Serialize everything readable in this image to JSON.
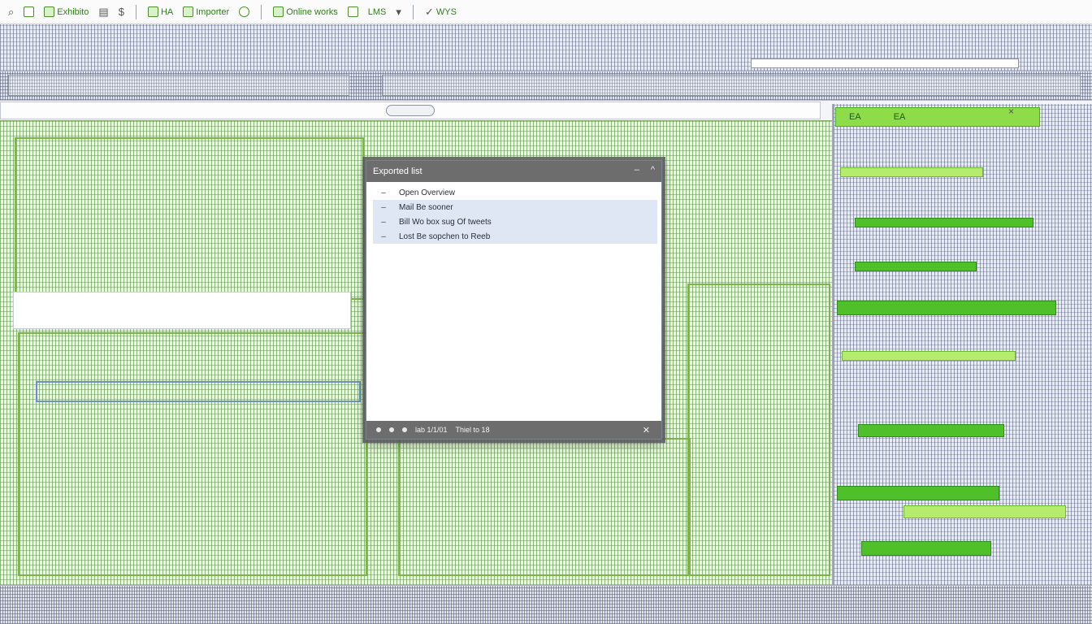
{
  "toolbar": {
    "items": [
      {
        "label": "",
        "icon": "search-icon"
      },
      {
        "label": "",
        "icon": "document-icon"
      },
      {
        "label": "Exhibito",
        "icon": "edit-icon"
      },
      {
        "label": "",
        "icon": "building-icon"
      },
      {
        "label": "",
        "icon": "dollar-icon"
      },
      {
        "label": "HA",
        "icon": "sheet-icon"
      },
      {
        "label": "Importer",
        "icon": "import-icon"
      },
      {
        "label": "",
        "icon": "settings-icon"
      },
      {
        "label": "Online works",
        "icon": "sheet-icon"
      },
      {
        "label": "",
        "icon": "grid-icon"
      },
      {
        "label": "LMS",
        "icon": "grid-icon"
      },
      {
        "label": "",
        "icon": "dropdown-icon"
      },
      {
        "label": "WYS",
        "icon": "check-icon"
      }
    ]
  },
  "dialog": {
    "title": "Exported list",
    "controls": [
      "–",
      "^"
    ],
    "rows": [
      {
        "label": "Open Overview",
        "selected": false
      },
      {
        "label": "Mail Be sooner",
        "selected": true
      },
      {
        "label": "Bill Wo box sug Of tweets",
        "selected": true
      },
      {
        "label": "Lost Be sopchen to Reeb",
        "selected": true
      }
    ],
    "footer_text": "lab 1/1/01",
    "footer_right": "Thiel to 18"
  },
  "right_panel": {
    "header": [
      "EA",
      "EA"
    ],
    "close": "×"
  },
  "colors": {
    "accent_green": "#4fc02a",
    "highlight_green": "#8fdc4a",
    "dialog_chrome": "#6d6d6d",
    "selection": "#dfe7f5"
  }
}
